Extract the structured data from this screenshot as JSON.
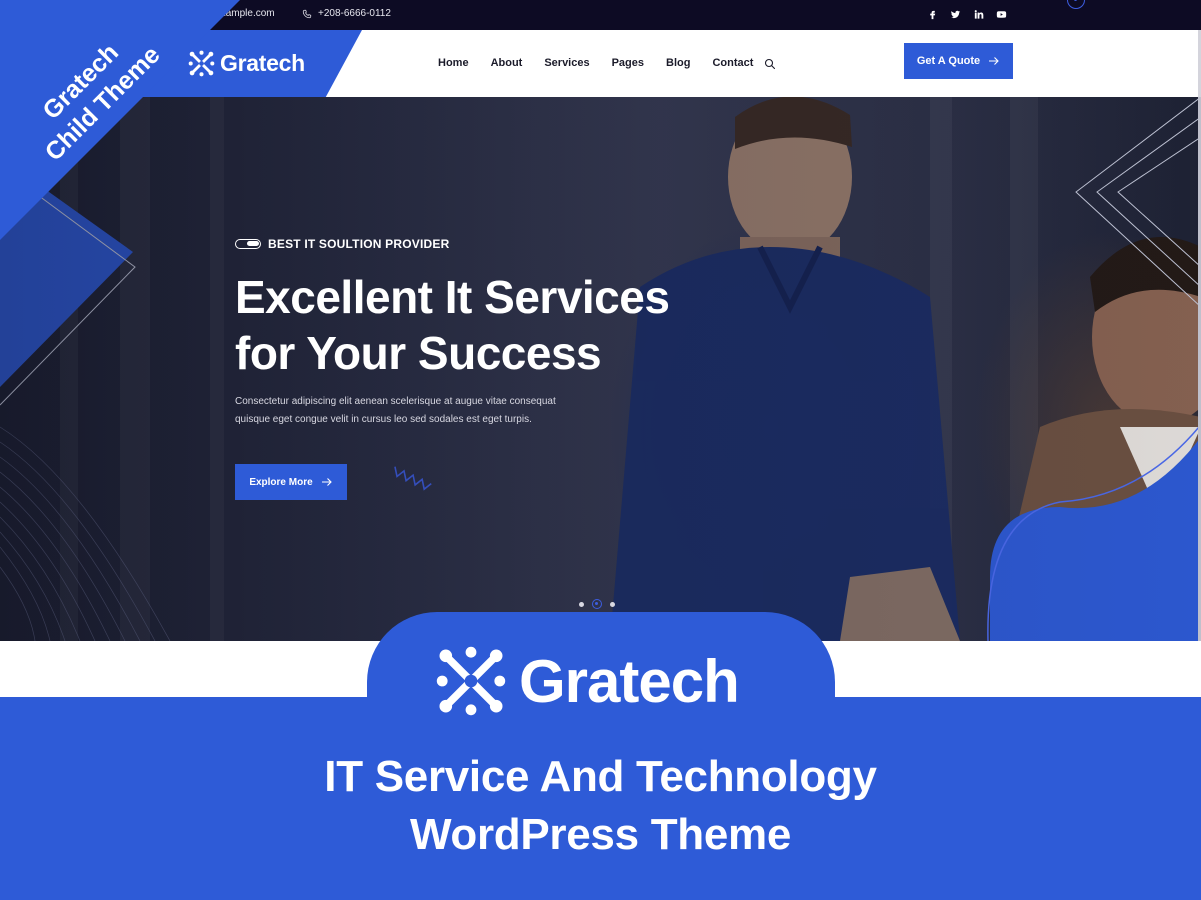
{
  "topbar": {
    "email": "@example.com",
    "phone": "+208-6666-0112",
    "social": [
      "facebook-icon",
      "twitter-icon",
      "linkedin-icon",
      "youtube-icon"
    ]
  },
  "header": {
    "brand": "Gratech",
    "nav": [
      "Home",
      "About",
      "Services",
      "Pages",
      "Blog",
      "Contact"
    ],
    "cta_label": "Get A Quote"
  },
  "hero": {
    "eyebrow": "BEST IT SOULTION PROVIDER",
    "title_line1": "Excellent It Services",
    "title_line2": "for Your Success",
    "text_line1": "Consectetur adipiscing elit aenean scelerisque at augue vitae consequat",
    "text_line2": "quisque eget congue velit in cursus leo sed sodales est eget turpis.",
    "button_label": "Explore More",
    "slider_dots": 3,
    "active_dot": 2
  },
  "corner_banner": {
    "line1": "Gratech",
    "line2": "Child Theme"
  },
  "promo": {
    "brand": "Gratech",
    "tagline_line1": "IT Service And Technology",
    "tagline_line2": "WordPress Theme"
  },
  "colors": {
    "brand_blue": "#2e5bd7",
    "topbar_bg": "#0d0b24",
    "text_dark": "#1b1b2a"
  }
}
